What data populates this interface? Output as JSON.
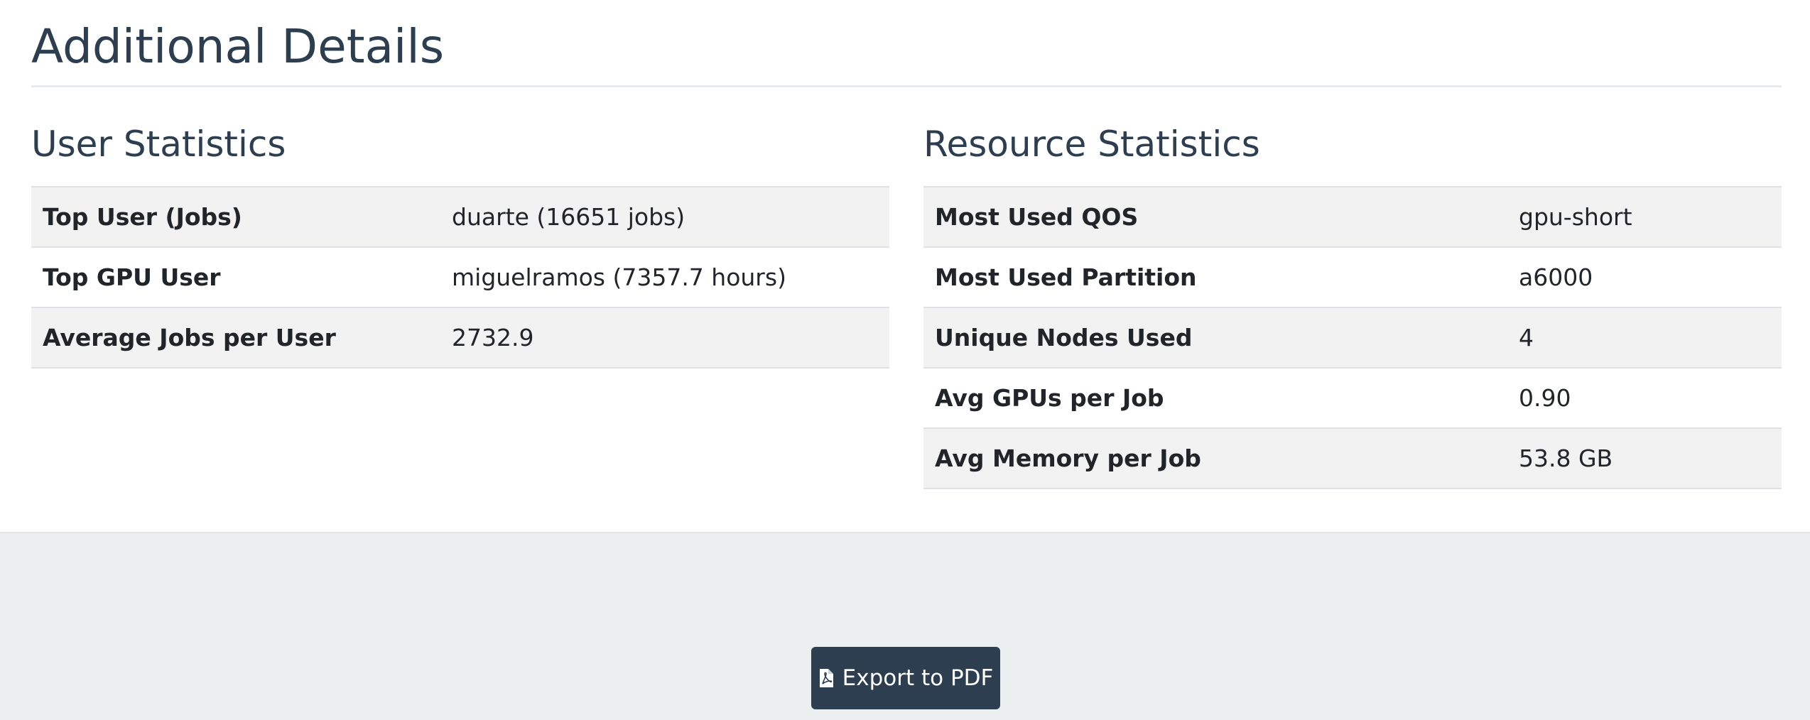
{
  "page": {
    "title": "Additional Details"
  },
  "user_statistics": {
    "title": "User Statistics",
    "rows": [
      {
        "label": "Top User (Jobs)",
        "value": "duarte (16651 jobs)"
      },
      {
        "label": "Top GPU User",
        "value": "miguelramos (7357.7 hours)"
      },
      {
        "label": "Average Jobs per User",
        "value": "2732.9"
      }
    ]
  },
  "resource_statistics": {
    "title": "Resource Statistics",
    "rows": [
      {
        "label": "Most Used QOS",
        "value": "gpu-short"
      },
      {
        "label": "Most Used Partition",
        "value": "a6000"
      },
      {
        "label": "Unique Nodes Used",
        "value": "4"
      },
      {
        "label": "Avg GPUs per Job",
        "value": "0.90"
      },
      {
        "label": "Avg Memory per Job",
        "value": "53.8 GB"
      }
    ]
  },
  "export": {
    "label": "Export to PDF",
    "icon": "file-pdf-icon"
  },
  "colors": {
    "heading": "#2c3e50",
    "button_bg": "#2c3e50",
    "page_bg": "#eceff0",
    "stripe": "#f2f2f2"
  }
}
